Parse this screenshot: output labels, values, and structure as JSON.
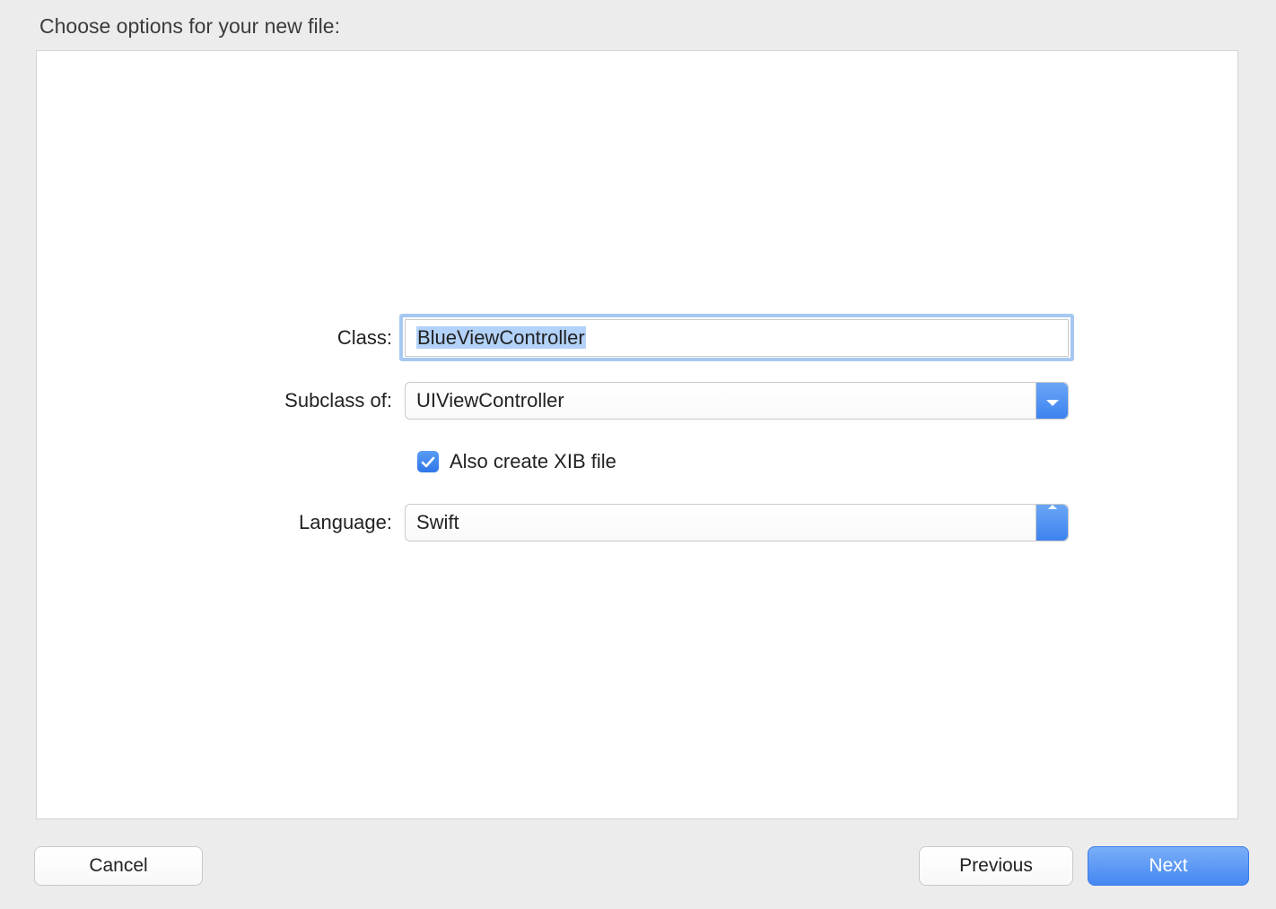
{
  "heading": "Choose options for your new file:",
  "form": {
    "class": {
      "label": "Class:",
      "value": "BlueViewController",
      "selected": true
    },
    "subclass": {
      "label": "Subclass of:",
      "value": "UIViewController"
    },
    "xib": {
      "label": "Also create XIB file",
      "checked": true
    },
    "language": {
      "label": "Language:",
      "value": "Swift"
    }
  },
  "buttons": {
    "cancel": "Cancel",
    "previous": "Previous",
    "next": "Next"
  }
}
